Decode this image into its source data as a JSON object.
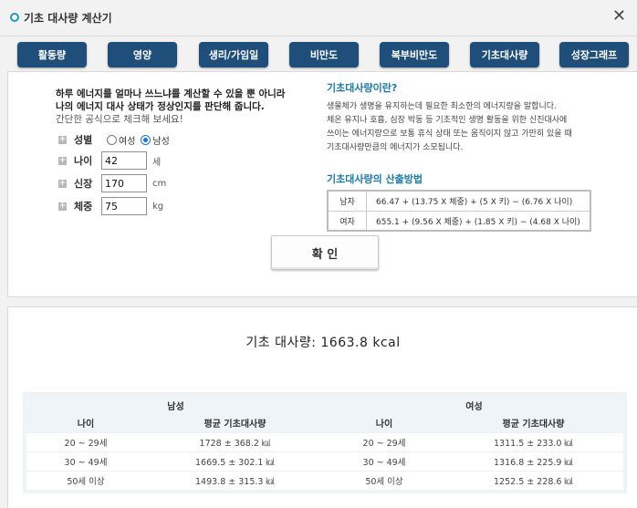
{
  "window": {
    "title": "기초 대사량 계산기",
    "close_icon": "close-icon"
  },
  "tabs": [
    {
      "label": "활동량"
    },
    {
      "label": "영양"
    },
    {
      "label": "생리/가임일"
    },
    {
      "label": "비만도"
    },
    {
      "label": "복부비만도"
    },
    {
      "label": "기초대사량"
    },
    {
      "label": "성장그래프"
    }
  ],
  "intro": {
    "line1": "하루 에너지를 얼마나 쓰느냐를 계산할 수 있을 뿐 아니라",
    "line2": "나의 에너지 대사 상태가 정상인지를 판단해 줍니다.",
    "line3": "간단한 공식으로 체크해 보세요!"
  },
  "form": {
    "gender_label": "성별",
    "female_label": "여성",
    "male_label": "남성",
    "selected_gender": "남성",
    "age_label": "나이",
    "age_value": "42",
    "age_unit": "세",
    "height_label": "신장",
    "height_value": "170",
    "height_unit": "cm",
    "weight_label": "체중",
    "weight_value": "75",
    "weight_unit": "kg",
    "confirm_label": "확 인"
  },
  "info": {
    "heading": "기초대사량이란?",
    "p1": "생물체가 생명을 유지하는데 필요한 최소한의 에너지량을 말합니다.",
    "p2": "체온 유지나 호흡, 심장 박동 등 기초적인 생명 활동을 위한 신진대사에",
    "p3": "쓰이는 에너지량으로 보통 휴식 상태 또는 움직이지 않고 가만히 있을 때",
    "p4": "기초대사량만큼의 에너지가 소모됩니다.",
    "method_heading": "기초대사량의 산출방법",
    "formulas": [
      {
        "gender": "남자",
        "formula": "66.47 + (13.75 X 체중) + (5 X 키) − (6.76 X 나이)"
      },
      {
        "gender": "여자",
        "formula": "655.1 + (9.56 X 체중) + (1.85 X 키) − (4.68 X 나이)"
      }
    ]
  },
  "result": {
    "text": "기초 대사량: 1663.8 kcal"
  },
  "reference": {
    "male_header": "남성",
    "female_header": "여성",
    "age_col": "나이",
    "avg_col": "평균 기초대사량",
    "rows": [
      {
        "m_age": "20 ~ 29세",
        "m_avg": "1728 ± 368.2 ㎉",
        "f_age": "20 ~ 29세",
        "f_avg": "1311.5 ± 233.0 ㎉"
      },
      {
        "m_age": "30 ~ 49세",
        "m_avg": "1669.5 ± 302.1 ㎉",
        "f_age": "30 ~ 49세",
        "f_avg": "1316.8 ± 225.9 ㎉"
      },
      {
        "m_age": "50세 이상",
        "m_avg": "1493.8 ± 315.3 ㎉",
        "f_age": "50세 이상",
        "f_avg": "1252.5 ± 228.6 ㎉"
      }
    ]
  },
  "colors": {
    "tab_bg": "#1e4e79",
    "heading_blue": "#1b7aa6",
    "table_header_bg": "#eef4f8"
  }
}
